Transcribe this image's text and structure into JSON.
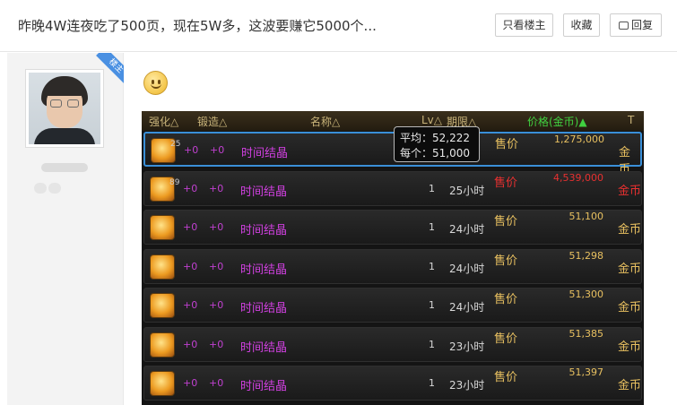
{
  "thread": {
    "title": "昨晚4W连夜吃了500页，现在5W多，这波要赚它5000个..."
  },
  "header_buttons": {
    "only_op": "只看楼主",
    "favorite": "收藏",
    "reply": "回复"
  },
  "author": {
    "badge": "楼主"
  },
  "game_table": {
    "columns": {
      "enhance": "强化△",
      "forge": "锻造△",
      "name": "名称△",
      "lv": "Lv△",
      "time_limit": "期限△",
      "price": "价格(金币)▲"
    },
    "tooltip": {
      "avg_label": "平均：",
      "avg_value": "52,222",
      "each_label": "每个：",
      "each_value": "51,000"
    },
    "rows": [
      {
        "count": "25",
        "enhance": "+0",
        "forge": "+0",
        "name": "时间结晶",
        "qty": "",
        "time": "",
        "sale": "售价",
        "price": "1,275,000",
        "currency": "金币",
        "color": "#e8c060"
      },
      {
        "count": "89",
        "enhance": "+0",
        "forge": "+0",
        "name": "时间结晶",
        "qty": "1",
        "time": "25小时",
        "sale": "售价",
        "price": "4,539,000",
        "currency": "金币",
        "color": "#e83030"
      },
      {
        "count": "",
        "enhance": "+0",
        "forge": "+0",
        "name": "时间结晶",
        "qty": "1",
        "time": "24小时",
        "sale": "售价",
        "price": "51,100",
        "currency": "金币",
        "color": "#e8c060"
      },
      {
        "count": "",
        "enhance": "+0",
        "forge": "+0",
        "name": "时间结晶",
        "qty": "1",
        "time": "24小时",
        "sale": "售价",
        "price": "51,298",
        "currency": "金币",
        "color": "#e8c060"
      },
      {
        "count": "",
        "enhance": "+0",
        "forge": "+0",
        "name": "时间结晶",
        "qty": "1",
        "time": "24小时",
        "sale": "售价",
        "price": "51,300",
        "currency": "金币",
        "color": "#e8c060"
      },
      {
        "count": "",
        "enhance": "+0",
        "forge": "+0",
        "name": "时间结晶",
        "qty": "1",
        "time": "23小时",
        "sale": "售价",
        "price": "51,385",
        "currency": "金币",
        "color": "#e8c060"
      },
      {
        "count": "",
        "enhance": "+0",
        "forge": "+0",
        "name": "时间结晶",
        "qty": "1",
        "time": "23小时",
        "sale": "售价",
        "price": "51,397",
        "currency": "金币",
        "color": "#e8c060"
      }
    ]
  },
  "colors": {
    "accent_blue": "#4a90e2",
    "selection": "#3a8fd8",
    "price_header": "#40d040",
    "item_name": "#d040e0"
  }
}
